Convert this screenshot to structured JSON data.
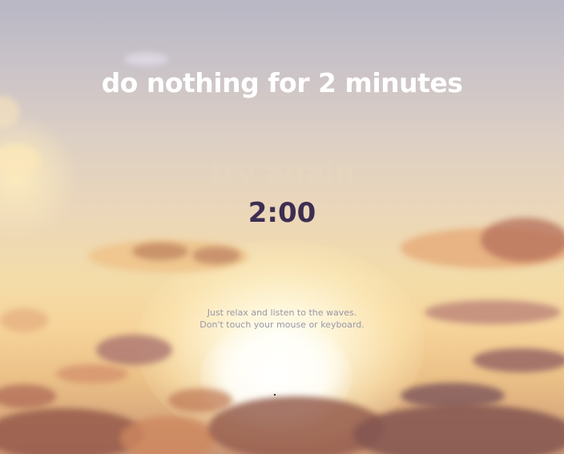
{
  "title": "do nothing for 2 minutes",
  "try_again": "try again",
  "timer": "2:00",
  "instructions": {
    "line1": "Just relax and listen to the waves.",
    "line2": "Don't touch your mouse or keyboard."
  },
  "colors": {
    "title": "#ffffff",
    "timer": "#3d2e52",
    "instructions": "#9a96a8"
  }
}
